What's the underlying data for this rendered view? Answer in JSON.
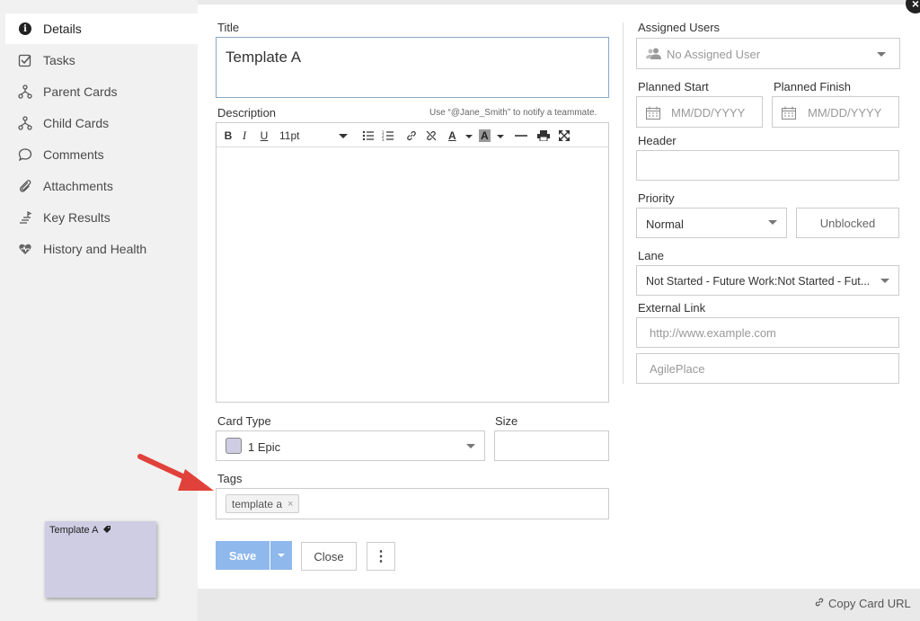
{
  "sidebar": {
    "items": [
      {
        "label": "Details",
        "icon": "info-icon"
      },
      {
        "label": "Tasks",
        "icon": "checkbox-icon"
      },
      {
        "label": "Parent Cards",
        "icon": "hierarchy-icon"
      },
      {
        "label": "Child Cards",
        "icon": "hierarchy-icon"
      },
      {
        "label": "Comments",
        "icon": "comment-icon"
      },
      {
        "label": "Attachments",
        "icon": "paperclip-icon"
      },
      {
        "label": "Key Results",
        "icon": "key-results-icon"
      },
      {
        "label": "History and Health",
        "icon": "heart-icon"
      }
    ]
  },
  "form": {
    "title_label": "Title",
    "title_value": "Template A",
    "description_label": "Description",
    "description_hint": "Use “@Jane_Smith” to notify a teammate.",
    "font_size": "11pt",
    "card_type_label": "Card Type",
    "card_type_value": "1 Epic",
    "card_type_color": "#cfcde3",
    "size_label": "Size",
    "tags_label": "Tags",
    "tag_value": "template a",
    "tag_remove": "×",
    "save_label": "Save",
    "close_label": "Close",
    "more_glyph": "⋮"
  },
  "right": {
    "assigned_users_label": "Assigned Users",
    "assigned_users_placeholder": "No Assigned User",
    "planned_start_label": "Planned Start",
    "planned_finish_label": "Planned Finish",
    "date_placeholder": "MM/DD/YYYY",
    "header_label": "Header",
    "priority_label": "Priority",
    "priority_value": "Normal",
    "blocked_label": "Unblocked",
    "lane_label": "Lane",
    "lane_value": "Not Started - Future Work:Not Started - Fut...",
    "external_link_label": "External Link",
    "external_link_placeholder": "http://www.example.com",
    "external_link_title_placeholder": "AgilePlace"
  },
  "footer": {
    "copy_url_label": "Copy Card URL"
  },
  "card_preview": {
    "title": "Template A",
    "color": "#cfcde3"
  },
  "colors": {
    "save_button": "#8fb8ec",
    "annotation_arrow": "#e0413a"
  }
}
